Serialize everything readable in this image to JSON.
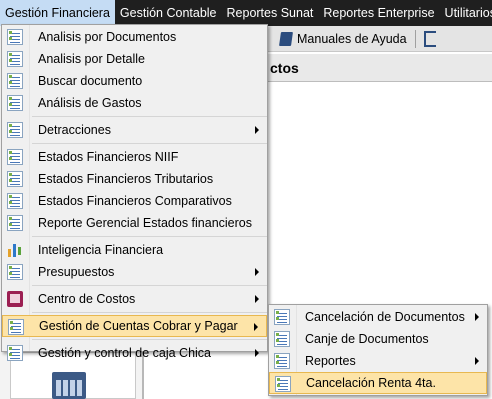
{
  "menubar": {
    "items": [
      {
        "label": "Gestión Financiera"
      },
      {
        "label": "Gestión Contable"
      },
      {
        "label": "Reportes Sunat"
      },
      {
        "label": "Reportes Enterprise"
      },
      {
        "label": "Utilitarios"
      }
    ]
  },
  "toolbar": {
    "help_label": "Manuales de Ayuda"
  },
  "background": {
    "header_text": "ctos"
  },
  "menu": {
    "items": [
      {
        "label": "Analisis por Documentos"
      },
      {
        "label": "Analisis por Detalle"
      },
      {
        "label": "Buscar documento"
      },
      {
        "label": "Análisis de Gastos"
      },
      {
        "label": "Detracciones"
      },
      {
        "label": "Estados Financieros NIIF"
      },
      {
        "label": "Estados Financieros Tributarios"
      },
      {
        "label": "Estados Financieros Comparativos"
      },
      {
        "label": "Reporte Gerencial Estados financieros"
      },
      {
        "label": "Inteligencia Financiera"
      },
      {
        "label": "Presupuestos"
      },
      {
        "label": "Centro de Costos"
      },
      {
        "label": "Gestión de Cuentas Cobrar y Pagar"
      },
      {
        "label": "Gestión y control de caja Chica"
      }
    ]
  },
  "submenu": {
    "items": [
      {
        "label": "Cancelación de Documentos"
      },
      {
        "label": "Canje de Documentos"
      },
      {
        "label": "Reportes"
      },
      {
        "label": "Cancelación Renta 4ta."
      }
    ]
  },
  "colors": {
    "menubar_bg": "#1f1f1f",
    "highlight_bg": "#fde4a8",
    "highlight_border": "#e8b850",
    "menu_bg": "#f0f0f0"
  }
}
